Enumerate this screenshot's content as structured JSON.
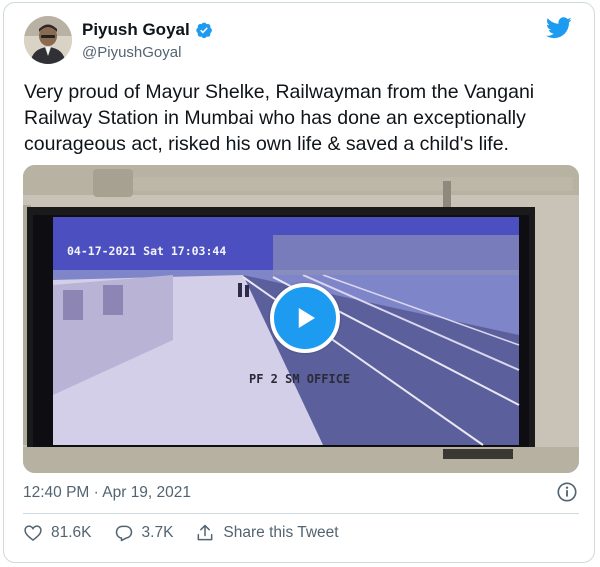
{
  "tweet": {
    "author_name": "Piyush Goyal",
    "author_handle": "@PiyushGoyal",
    "text": "Very proud of Mayur Shelke, Railwayman from the Vangani Railway Station in Mumbai who has done an exceptionally courageous act, risked his own life & saved a child's life.",
    "timestamp": "12:40 PM · Apr 19, 2021"
  },
  "video": {
    "overlay_datetime": "04-17-2021 Sat 17:03:44",
    "overlay_label": "PF 2 SM OFFICE"
  },
  "actions": {
    "likes": "81.6K",
    "replies": "3.7K",
    "share_label": "Share this Tweet"
  },
  "colors": {
    "accent": "#1d9bf0",
    "secondary_text": "#536471",
    "border": "#cfd9de"
  },
  "icons": [
    "twitter-bird-icon",
    "verified-badge-icon",
    "play-icon",
    "info-icon",
    "heart-icon",
    "reply-icon",
    "share-icon"
  ]
}
